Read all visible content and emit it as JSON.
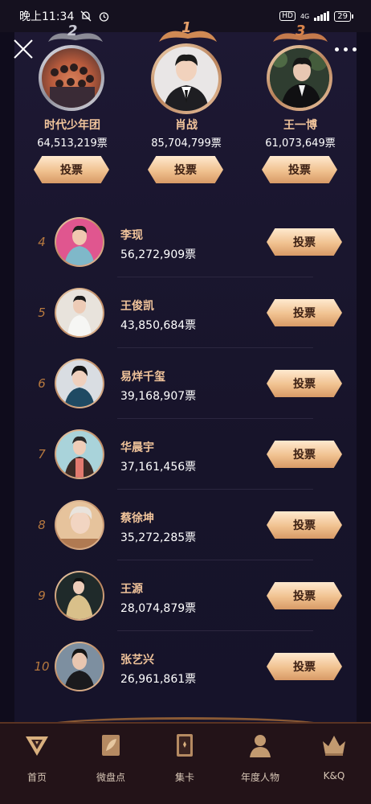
{
  "status_bar": {
    "time": "晚上11:34",
    "network": "4G",
    "hd": "HD",
    "battery": "29"
  },
  "podium": [
    {
      "rank": "2",
      "name": "时代少年团",
      "votes": "64,513,219票",
      "vote_label": "投票"
    },
    {
      "rank": "1",
      "name": "肖战",
      "votes": "85,704,799票",
      "vote_label": "投票"
    },
    {
      "rank": "3",
      "name": "王一博",
      "votes": "61,073,649票",
      "vote_label": "投票"
    }
  ],
  "list": [
    {
      "rank": "4",
      "name": "李现",
      "votes": "56,272,909票",
      "vote_label": "投票"
    },
    {
      "rank": "5",
      "name": "王俊凯",
      "votes": "43,850,684票",
      "vote_label": "投票"
    },
    {
      "rank": "6",
      "name": "易烊千玺",
      "votes": "39,168,907票",
      "vote_label": "投票"
    },
    {
      "rank": "7",
      "name": "华晨宇",
      "votes": "37,161,456票",
      "vote_label": "投票"
    },
    {
      "rank": "8",
      "name": "蔡徐坤",
      "votes": "35,272,285票",
      "vote_label": "投票"
    },
    {
      "rank": "9",
      "name": "王源",
      "votes": "28,074,879票",
      "vote_label": "投票"
    },
    {
      "rank": "10",
      "name": "张艺兴",
      "votes": "26,961,861票",
      "vote_label": "投票"
    }
  ],
  "bottom_nav": [
    {
      "label": "首页",
      "icon": "diamond-logo-icon"
    },
    {
      "label": "微盘点",
      "icon": "leaf-card-icon"
    },
    {
      "label": "集卡",
      "icon": "card-icon"
    },
    {
      "label": "年度人物",
      "icon": "person-icon"
    },
    {
      "label": "K&Q",
      "icon": "crown-icon"
    }
  ],
  "colors": {
    "accent_gold": "#f1c49b",
    "button_gold": "#f0c18f",
    "background": "#0f0c1c",
    "rank_orange": "#b7793f"
  }
}
